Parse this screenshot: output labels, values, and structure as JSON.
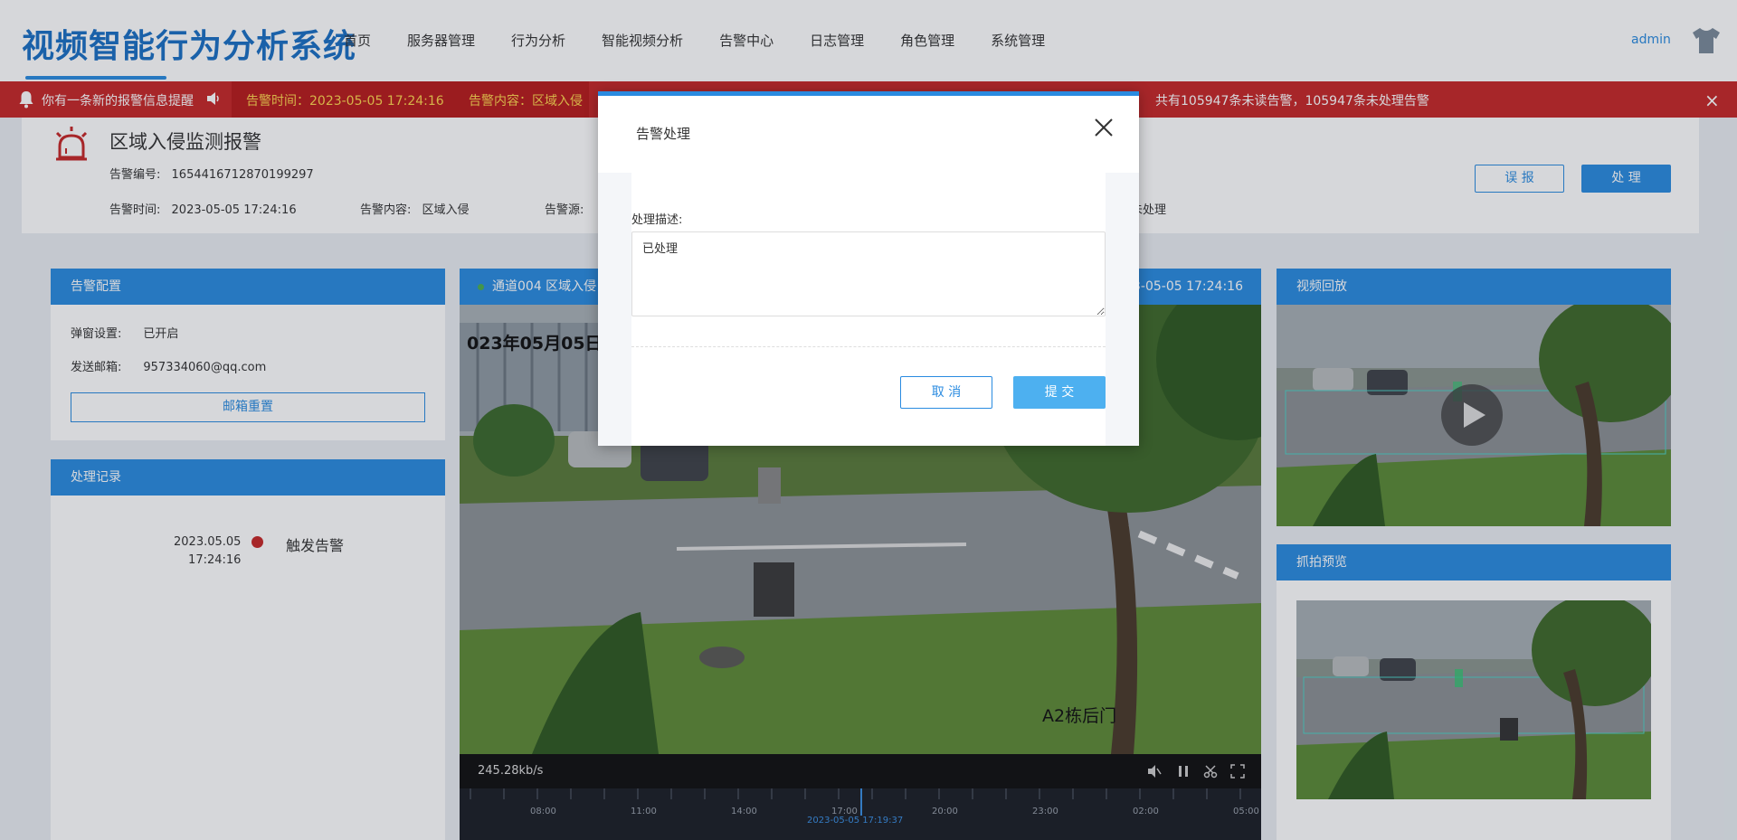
{
  "app": {
    "title": "视频智能行为分析系统",
    "username": "admin"
  },
  "nav": {
    "items": [
      "首页",
      "服务器管理",
      "行为分析",
      "智能视频分析",
      "告警中心",
      "日志管理",
      "角色管理",
      "系统管理"
    ]
  },
  "alertbar": {
    "new_message": "你有一条新的报警信息提醒",
    "alarm_time": "告警时间：2023-05-05 17:24:16",
    "alarm_content": "告警内容：区域入侵",
    "summary": "共有105947条未读告警，105947条未处理告警",
    "close": "×"
  },
  "info": {
    "title": "区域入侵监测报警",
    "id_label": "告警编号:",
    "id_value": "1654416712870199297",
    "time_label": "告警时间:",
    "time_value": "2023-05-05 17:24:16",
    "content_label": "告警内容:",
    "content_value": "区域入侵",
    "source_label": "告警源:",
    "status_partial": "未处理",
    "misreport_button": "误 报",
    "handle_button": "处 理"
  },
  "config_panel": {
    "title": "告警配置",
    "popup_label": "弹窗设置:",
    "popup_value": "已开启",
    "email_label": "发送邮箱:",
    "email_value": "957334060@qq.com",
    "reset_button": "邮箱重置"
  },
  "record_panel": {
    "title": "处理记录",
    "date": "2023.05.05",
    "time": "17:24:16",
    "event": "触发告警"
  },
  "video": {
    "channel_title": "通道004 区域入侵",
    "header_time": "2023-05-05 17:24:16",
    "osd_text": "023年05月05日",
    "camera_name": "A2栋后门",
    "bitrate": "245.28kb/s",
    "timeline_labels": [
      "08:00",
      "11:00",
      "14:00",
      "17:00",
      "20:00",
      "23:00",
      "02:00",
      "05:00"
    ],
    "current_time": "2023-05-05 17:19:37"
  },
  "playback_panel": {
    "title": "视频回放"
  },
  "snapshot_panel": {
    "title": "抓拍预览"
  },
  "modal": {
    "title": "告警处理",
    "description_label": "处理描述:",
    "description_value": "已处理",
    "cancel_button": "取 消",
    "submit_button": "提 交"
  },
  "colors": {
    "primary": "#2a8be0",
    "alert_red": "#c62828",
    "alert_text": "#ffd54f"
  }
}
